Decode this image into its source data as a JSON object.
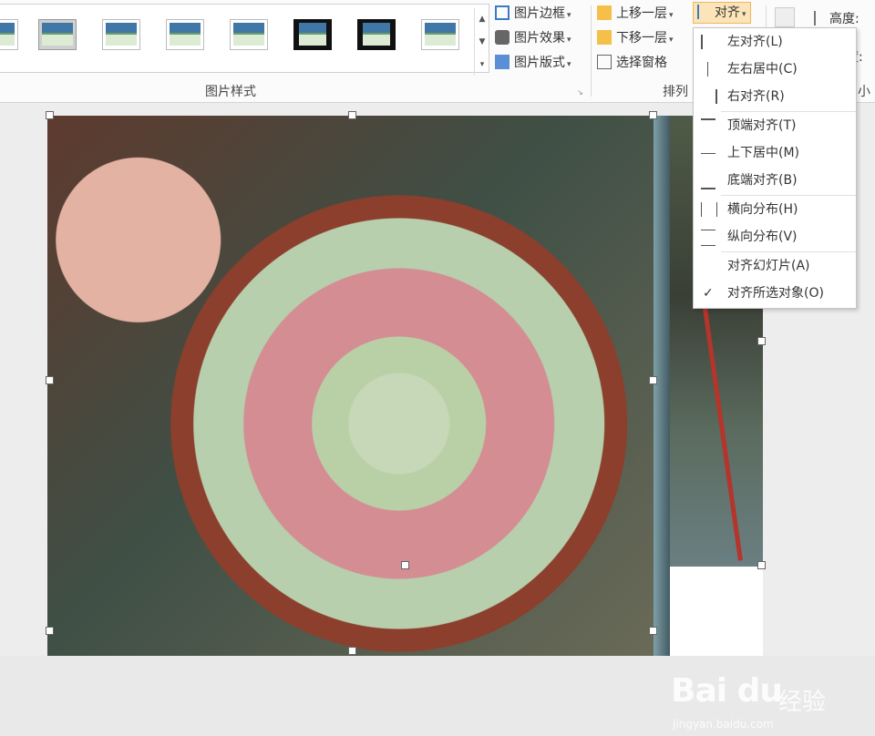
{
  "ribbon": {
    "picture_styles_label": "图片样式",
    "arrange_label": "排列",
    "size_label": "小",
    "picture_border": "图片边框",
    "picture_effects": "图片效果",
    "picture_layout": "图片版式",
    "bring_forward": "上移一层",
    "send_backward": "下移一层",
    "selection_pane": "选择窗格",
    "align": "对齐",
    "height_label": "高度:",
    "width_label": "度:"
  },
  "align_menu": {
    "items": [
      {
        "label": "左对齐(L)",
        "icon": "align-left-icon"
      },
      {
        "label": "左右居中(C)",
        "icon": "align-center-icon"
      },
      {
        "label": "右对齐(R)",
        "icon": "align-right-icon"
      },
      {
        "label": "顶端对齐(T)",
        "icon": "align-top-icon"
      },
      {
        "label": "上下居中(M)",
        "icon": "align-middle-icon"
      },
      {
        "label": "底端对齐(B)",
        "icon": "align-bottom-icon"
      },
      {
        "label": "横向分布(H)",
        "icon": "distribute-horizontal-icon"
      },
      {
        "label": "纵向分布(V)",
        "icon": "distribute-vertical-icon"
      },
      {
        "label": "对齐幻灯片(A)",
        "icon": ""
      },
      {
        "label": "对齐所选对象(O)",
        "icon": "",
        "checked": true
      }
    ]
  },
  "watermark": {
    "brand": "Bai du",
    "brand_cn": "经验",
    "url": "jingyan.baidu.com"
  },
  "colors": {
    "accent_highlight": "#fce4b8",
    "menu_border": "#c6c6c6"
  }
}
